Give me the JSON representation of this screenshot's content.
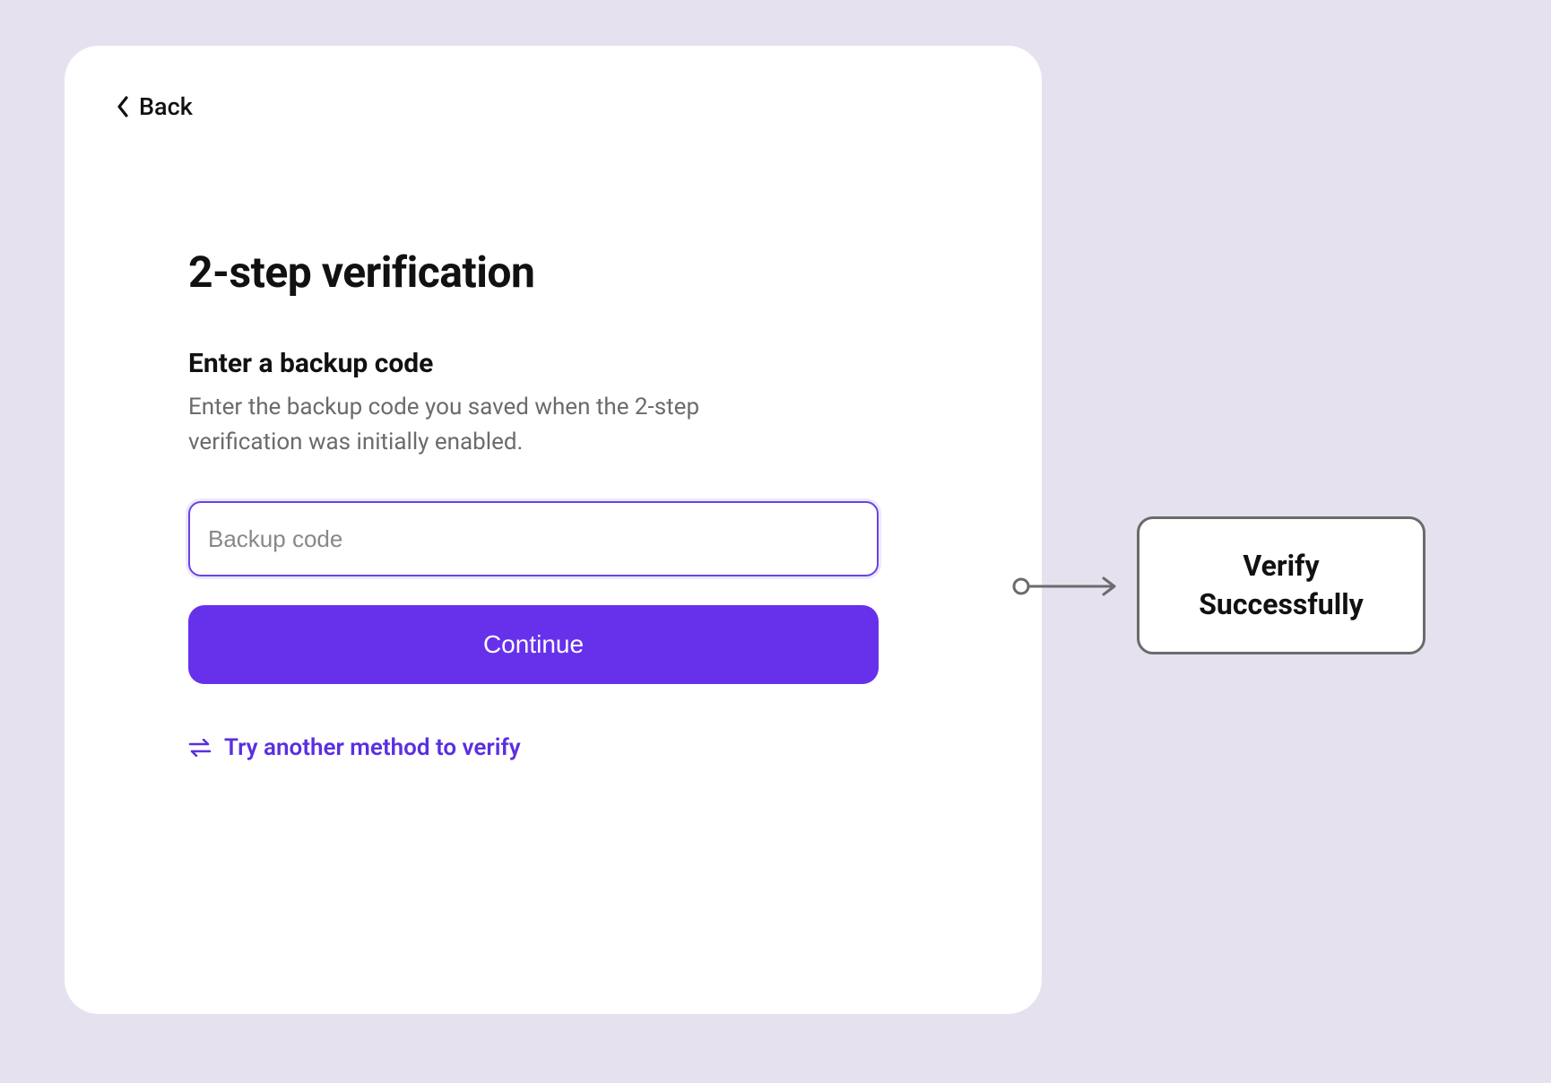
{
  "back": {
    "label": "Back"
  },
  "page": {
    "title": "2-step verification",
    "subtitle": "Enter a backup code",
    "description": "Enter the backup code you saved when the 2-step verification was initially enabled."
  },
  "input": {
    "placeholder": "Backup code",
    "value": ""
  },
  "actions": {
    "continue_label": "Continue",
    "alt_method_label": "Try another method to verify"
  },
  "result_node": {
    "label": "Verify\nSuccessfully"
  },
  "colors": {
    "accent": "#6731ec",
    "input_border": "#6a42e8",
    "page_bg": "#e6e1ef"
  }
}
